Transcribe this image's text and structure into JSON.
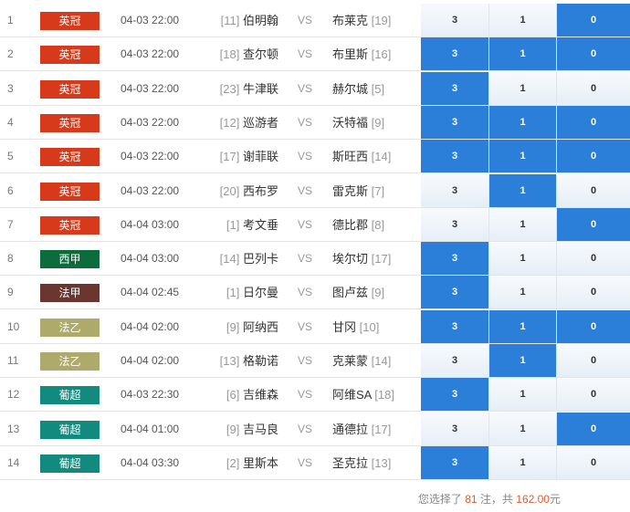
{
  "colors": {
    "league_premier": "#d63a1a",
    "league_laliga": "#0d6c3c",
    "league_ligue1": "#6b3530",
    "league_ligue2": "#aeaa6c",
    "league_portugal": "#138a7e",
    "selected": "#2b7fd8"
  },
  "vs_label": "VS",
  "matches": [
    {
      "num": "1",
      "league": "英冠",
      "league_color": "#d63a1a",
      "time": "04-03 22:00",
      "home_rank": "[11]",
      "home": "伯明翰",
      "away": "布莱克",
      "away_rank": "[19]",
      "options": [
        {
          "label": "3",
          "selected": false
        },
        {
          "label": "1",
          "selected": false
        },
        {
          "label": "0",
          "selected": true
        }
      ]
    },
    {
      "num": "2",
      "league": "英冠",
      "league_color": "#d63a1a",
      "time": "04-03 22:00",
      "home_rank": "[18]",
      "home": "查尔顿",
      "away": "布里斯",
      "away_rank": "[16]",
      "options": [
        {
          "label": "3",
          "selected": true
        },
        {
          "label": "1",
          "selected": true
        },
        {
          "label": "0",
          "selected": true
        }
      ]
    },
    {
      "num": "3",
      "league": "英冠",
      "league_color": "#d63a1a",
      "time": "04-03 22:00",
      "home_rank": "[23]",
      "home": "牛津联",
      "away": "赫尔城",
      "away_rank": "[5]",
      "options": [
        {
          "label": "3",
          "selected": true
        },
        {
          "label": "1",
          "selected": false
        },
        {
          "label": "0",
          "selected": false
        }
      ]
    },
    {
      "num": "4",
      "league": "英冠",
      "league_color": "#d63a1a",
      "time": "04-03 22:00",
      "home_rank": "[12]",
      "home": "巡游者",
      "away": "沃特福",
      "away_rank": "[9]",
      "options": [
        {
          "label": "3",
          "selected": true
        },
        {
          "label": "1",
          "selected": true
        },
        {
          "label": "0",
          "selected": true
        }
      ]
    },
    {
      "num": "5",
      "league": "英冠",
      "league_color": "#d63a1a",
      "time": "04-03 22:00",
      "home_rank": "[17]",
      "home": "谢菲联",
      "away": "斯旺西",
      "away_rank": "[14]",
      "options": [
        {
          "label": "3",
          "selected": true
        },
        {
          "label": "1",
          "selected": true
        },
        {
          "label": "0",
          "selected": true
        }
      ]
    },
    {
      "num": "6",
      "league": "英冠",
      "league_color": "#d63a1a",
      "time": "04-03 22:00",
      "home_rank": "[20]",
      "home": "西布罗",
      "away": "雷克斯",
      "away_rank": "[7]",
      "options": [
        {
          "label": "3",
          "selected": false
        },
        {
          "label": "1",
          "selected": true
        },
        {
          "label": "0",
          "selected": false
        }
      ]
    },
    {
      "num": "7",
      "league": "英冠",
      "league_color": "#d63a1a",
      "time": "04-04 03:00",
      "home_rank": "[1]",
      "home": "考文垂",
      "away": "德比郡",
      "away_rank": "[8]",
      "options": [
        {
          "label": "3",
          "selected": false
        },
        {
          "label": "1",
          "selected": false
        },
        {
          "label": "0",
          "selected": true
        }
      ]
    },
    {
      "num": "8",
      "league": "西甲",
      "league_color": "#0d6c3c",
      "time": "04-04 03:00",
      "home_rank": "[14]",
      "home": "巴列卡",
      "away": "埃尔切",
      "away_rank": "[17]",
      "options": [
        {
          "label": "3",
          "selected": true
        },
        {
          "label": "1",
          "selected": false
        },
        {
          "label": "0",
          "selected": false
        }
      ]
    },
    {
      "num": "9",
      "league": "法甲",
      "league_color": "#6b3530",
      "time": "04-04 02:45",
      "home_rank": "[1]",
      "home": "日尔曼",
      "away": "图卢兹",
      "away_rank": "[9]",
      "options": [
        {
          "label": "3",
          "selected": true
        },
        {
          "label": "1",
          "selected": false
        },
        {
          "label": "0",
          "selected": false
        }
      ]
    },
    {
      "num": "10",
      "league": "法乙",
      "league_color": "#aeaa6c",
      "time": "04-04 02:00",
      "home_rank": "[9]",
      "home": "阿纳西",
      "away": "甘冈",
      "away_rank": "[10]",
      "options": [
        {
          "label": "3",
          "selected": true
        },
        {
          "label": "1",
          "selected": true
        },
        {
          "label": "0",
          "selected": true
        }
      ]
    },
    {
      "num": "11",
      "league": "法乙",
      "league_color": "#aeaa6c",
      "time": "04-04 02:00",
      "home_rank": "[13]",
      "home": "格勒诺",
      "away": "克莱蒙",
      "away_rank": "[14]",
      "options": [
        {
          "label": "3",
          "selected": false
        },
        {
          "label": "1",
          "selected": true
        },
        {
          "label": "0",
          "selected": false
        }
      ]
    },
    {
      "num": "12",
      "league": "葡超",
      "league_color": "#138a7e",
      "time": "04-03 22:30",
      "home_rank": "[6]",
      "home": "吉维森",
      "away": "阿维SA",
      "away_rank": "[18]",
      "options": [
        {
          "label": "3",
          "selected": true
        },
        {
          "label": "1",
          "selected": false
        },
        {
          "label": "0",
          "selected": false
        }
      ]
    },
    {
      "num": "13",
      "league": "葡超",
      "league_color": "#138a7e",
      "time": "04-04 01:00",
      "home_rank": "[9]",
      "home": "吉马良",
      "away": "通德拉",
      "away_rank": "[17]",
      "options": [
        {
          "label": "3",
          "selected": false
        },
        {
          "label": "1",
          "selected": false
        },
        {
          "label": "0",
          "selected": true
        }
      ]
    },
    {
      "num": "14",
      "league": "葡超",
      "league_color": "#138a7e",
      "time": "04-04 03:30",
      "home_rank": "[2]",
      "home": "里斯本",
      "away": "圣克拉",
      "away_rank": "[13]",
      "options": [
        {
          "label": "3",
          "selected": true
        },
        {
          "label": "1",
          "selected": false
        },
        {
          "label": "0",
          "selected": false
        }
      ]
    }
  ],
  "summary": {
    "prefix": "您选择了",
    "bets": "81",
    "bets_unit": "注，共",
    "amount": "162.00",
    "currency": "元"
  }
}
